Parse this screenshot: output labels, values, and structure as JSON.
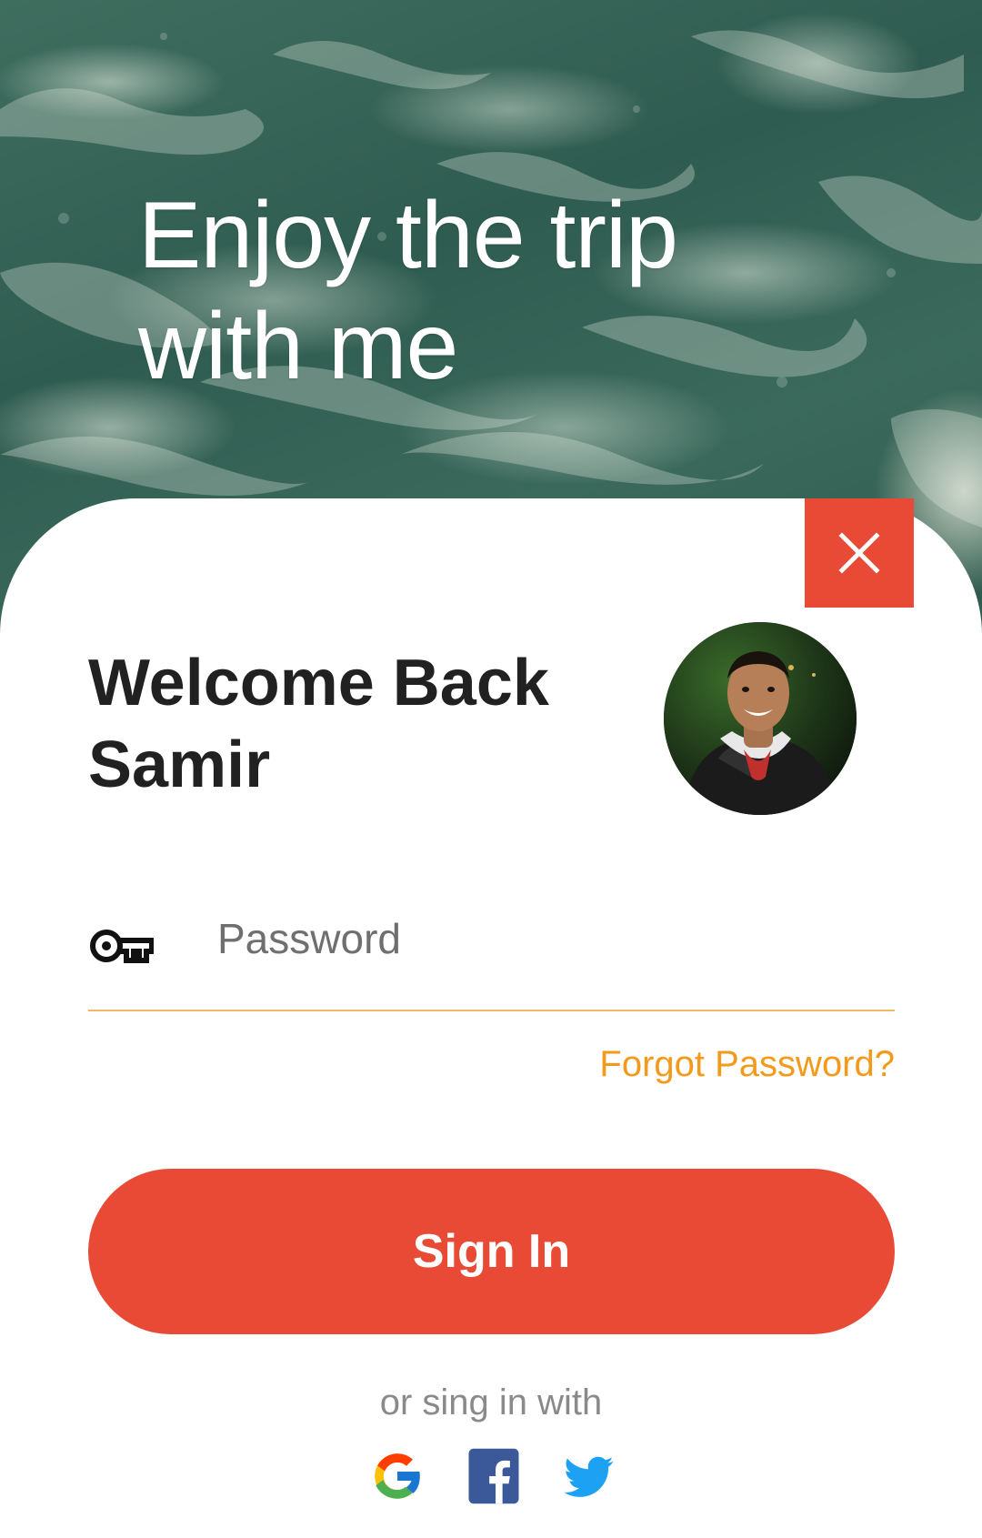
{
  "hero": {
    "title": "Enjoy the trip with me"
  },
  "card": {
    "welcome": "Welcome Back Samir",
    "close_icon": "close-icon",
    "avatar_icon": "user-avatar-photo"
  },
  "password": {
    "icon": "key-icon",
    "placeholder": "Password",
    "value": ""
  },
  "links": {
    "forgot_password": "Forgot Password?"
  },
  "actions": {
    "sign_in": "Sign In"
  },
  "social": {
    "label": "or sing in with",
    "providers": [
      "google-icon",
      "facebook-icon",
      "twitter-icon"
    ]
  },
  "colors": {
    "accent": "#e84a35",
    "link": "#f39a1a",
    "underline": "#f2b76a",
    "title_text": "#212121",
    "muted": "#8a8a8a"
  }
}
